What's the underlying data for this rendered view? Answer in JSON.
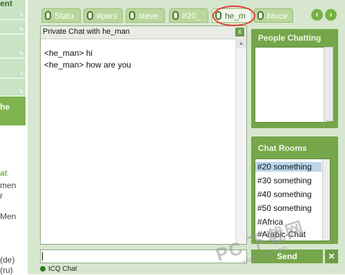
{
  "left_sidebar": {
    "nav_items": [
      {
        "label": "ent",
        "arrow": "↘"
      },
      {
        "label": "",
        "arrow": "↘"
      },
      {
        "label": "",
        "arrow": "↘"
      },
      {
        "label": "",
        "arrow": "↘"
      },
      {
        "label": "",
        "arrow": "↘"
      }
    ],
    "selected_label": "he",
    "side_texts": [
      "at",
      "men",
      "r",
      "Men",
      "(de)",
      "(ru)"
    ]
  },
  "tabs": [
    {
      "label": "Statu",
      "active": false
    },
    {
      "label": "#pers",
      "active": false
    },
    {
      "label": "steve",
      "active": false
    },
    {
      "label": "#20_",
      "active": false
    },
    {
      "label": "he_m",
      "active": true
    },
    {
      "label": "bruce",
      "active": false
    }
  ],
  "nav": {
    "prev": "‹",
    "next": "›"
  },
  "chat": {
    "title": "Private Chat with he_man",
    "close": "x",
    "messages": [
      "<he_man> hi",
      "<he_man> how are you"
    ]
  },
  "people_panel": {
    "heading": "People Chatting"
  },
  "rooms_panel": {
    "heading": "Chat Rooms",
    "rooms": [
      "#20  something",
      "#30  something",
      "#40  something",
      "#50  something",
      "#Africa",
      "#Arabic-Chat"
    ],
    "selected_index": 0
  },
  "input": {
    "value": ""
  },
  "send_button": {
    "label": "Send"
  },
  "x_button": {
    "label": "✕"
  },
  "footer": {
    "label": "ICQ Chat"
  },
  "watermark": {
    "main": "PC 下载网",
    "sub": "www.pc6.com"
  }
}
